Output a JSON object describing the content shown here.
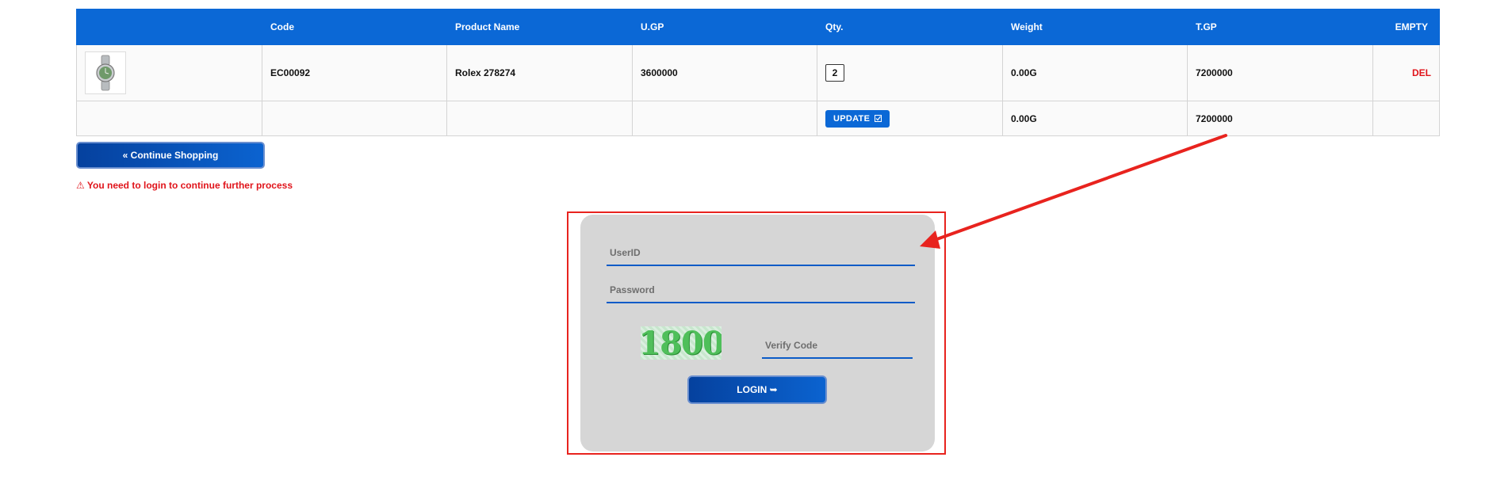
{
  "cart": {
    "headers": [
      "",
      "Code",
      "Product Name",
      "U.GP",
      "Qty.",
      "Weight",
      "T.GP",
      "EMPTY"
    ],
    "item": {
      "image_icon": "watch-icon",
      "code": "EC00092",
      "product_name": "Rolex 278274",
      "ugp": "3600000",
      "qty": "2",
      "weight": "0.00G",
      "tgp": "7200000",
      "del_label": "DEL"
    },
    "total": {
      "update_label": "UPDATE",
      "update_icon": "checkbox-icon",
      "weight": "0.00G",
      "tgp": "7200000"
    }
  },
  "continue_label": "« Continue Shopping",
  "warning_text": "⚠ You need to login to continue further process",
  "login": {
    "userid_placeholder": "UserID",
    "password_placeholder": "Password",
    "captcha_text": "1800",
    "verify_placeholder": "Verify Code",
    "login_label": "LOGIN ➥"
  },
  "colors": {
    "header_blue": "#0b68d6",
    "annotation_red": "#e8231e",
    "delete_red": "#e0141b"
  }
}
